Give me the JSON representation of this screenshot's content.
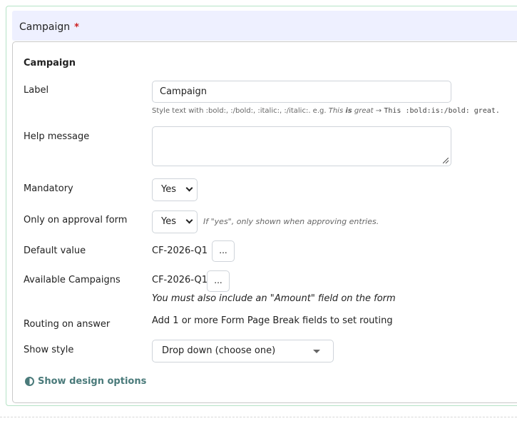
{
  "header": {
    "title": "Campaign",
    "required_marker": "*"
  },
  "panel": {
    "title": "Campaign"
  },
  "label_row": {
    "label": "Label",
    "value": "Campaign"
  },
  "label_hint": {
    "prefix": "Style text with :bold:, :/bold:, :italic:, :/italic:. e.g.",
    "example_italic_1": "This",
    "example_bold": "is",
    "example_italic_2": "great",
    "arrow": "→",
    "example_code": "This :bold:is:/bold: great."
  },
  "help_row": {
    "label": "Help message",
    "value": ""
  },
  "mandatory_row": {
    "label": "Mandatory",
    "selected": "Yes"
  },
  "approval_row": {
    "label": "Only on approval form",
    "selected": "Yes",
    "note": "If \"yes\", only shown when approving entries."
  },
  "default_row": {
    "label": "Default value",
    "value": "CF-2026-Q1",
    "button": "..."
  },
  "campaigns_row": {
    "label": "Available Campaigns",
    "value": "CF-2026-Q1",
    "button": "...",
    "warning": "You must also include an \"Amount\" field on the form"
  },
  "routing_row": {
    "label": "Routing on answer",
    "value": "Add 1 or more Form Page Break fields to set routing"
  },
  "style_row": {
    "label": "Show style",
    "selected": "Drop down (choose one)"
  },
  "design_link": {
    "label": "Show design options",
    "icon": "contrast-icon"
  },
  "colors": {
    "accent_link": "#4a7a7a",
    "header_bg": "#eef0ff",
    "outer_border": "#b6e3c6",
    "required": "#cc1f1f"
  }
}
